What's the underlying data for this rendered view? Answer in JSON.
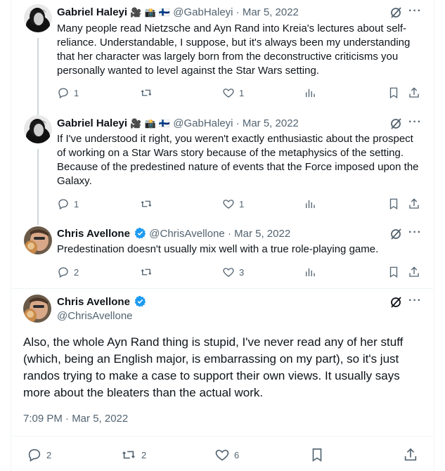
{
  "tweets": [
    {
      "name": "Gabriel Haleyi",
      "badges": "🎥 📸 🇫🇮",
      "handle": "@GabHaleyi",
      "date": "Mar 5, 2022",
      "text": "Many people read Nietzsche and Ayn Rand into Kreia's lectures about self-reliance. Understandable, I suppose, but it's always been my understanding that her character was largely born from the deconstructive criticisms you personally wanted to level against the Star Wars setting.",
      "replies": "1",
      "retweets": "",
      "likes": "1"
    },
    {
      "name": "Gabriel Haleyi",
      "badges": "🎥 📸 🇫🇮",
      "handle": "@GabHaleyi",
      "date": "Mar 5, 2022",
      "text": "If I've understood it right, you weren't exactly enthusiastic about the prospect of working on a Star Wars story because of the metaphysics of the setting. Because of the predestined nature of events that the Force imposed upon the Galaxy.",
      "replies": "1",
      "retweets": "",
      "likes": "1"
    },
    {
      "name": "Chris Avellone",
      "handle": "@ChrisAvellone",
      "date": "Mar 5, 2022",
      "text": "Predestination doesn't usually mix well with a true role-playing game.",
      "replies": "2",
      "retweets": "",
      "likes": "3"
    }
  ],
  "main": {
    "name": "Chris Avellone",
    "handle": "@ChrisAvellone",
    "text": "Also, the whole Ayn Rand thing is stupid, I've never read any of her stuff (which, being an English major, is embarrassing on my part), so it's just randos trying to make a case to support their own views. It usually says more about the bleaters than the actual work.",
    "timestamp": "7:09 PM · Mar 5, 2022",
    "replies": "2",
    "retweets": "2",
    "likes": "6"
  },
  "icons": {
    "more": "···",
    "grok": "grok-icon",
    "verified_color": "#1d9bf0"
  }
}
